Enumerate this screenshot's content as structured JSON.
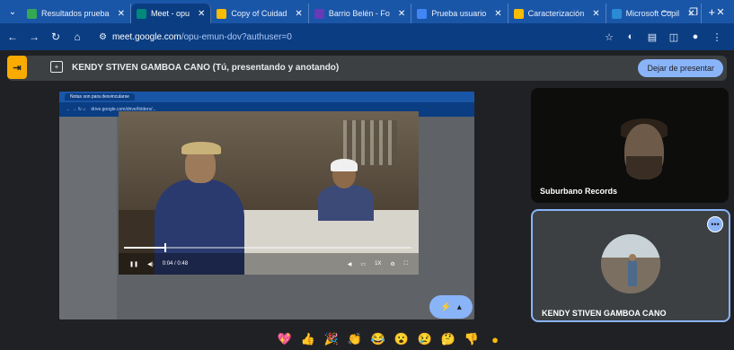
{
  "browser": {
    "tabs": [
      {
        "label": "Resultados prueba",
        "favicon_color": "#34a853",
        "active": false
      },
      {
        "label": "Meet - opu",
        "favicon_color": "#00897b",
        "active": true
      },
      {
        "label": "Copy of Cuidad",
        "favicon_color": "#fbbc04",
        "active": false
      },
      {
        "label": "Barrio Belén - Fo",
        "favicon_color": "#673ab7",
        "active": false
      },
      {
        "label": "Prueba usuario",
        "favicon_color": "#4285f4",
        "active": false
      },
      {
        "label": "Caracterización",
        "favicon_color": "#fbbc04",
        "active": false
      },
      {
        "label": "Microsoft Copil",
        "favicon_color": "#2a8bd6",
        "active": false
      }
    ],
    "url_host": "meet.google.com",
    "url_path": "/opu-emun-dov?authuser=0"
  },
  "meet": {
    "presenter_title": "KENDY STIVEN GAMBOA CANO (Tú, presentando y anotando)",
    "stop_presenting_label": "Dejar de presentar",
    "shared_screen": {
      "inner_tab": "Notas son para desvincularse",
      "inner_url": "drive.google.com/drive/folders/...",
      "time_label": "0:04 / 0:48",
      "speed_label": "1X",
      "progress": 0.14
    },
    "participants": [
      {
        "name": "Suburbano Records"
      },
      {
        "name": "KENDY STIVEN GAMBOA CANO"
      }
    ],
    "more_label": "•••"
  },
  "reactions": [
    "💖",
    "👍",
    "🎉",
    "👏",
    "😂",
    "😮",
    "😢",
    "🤔",
    "👎",
    "●"
  ],
  "colors": {
    "chrome_blue": "#1a56a8",
    "meet_bg": "#202124",
    "accent": "#8ab4f8",
    "presenting": "#f9ab00"
  }
}
